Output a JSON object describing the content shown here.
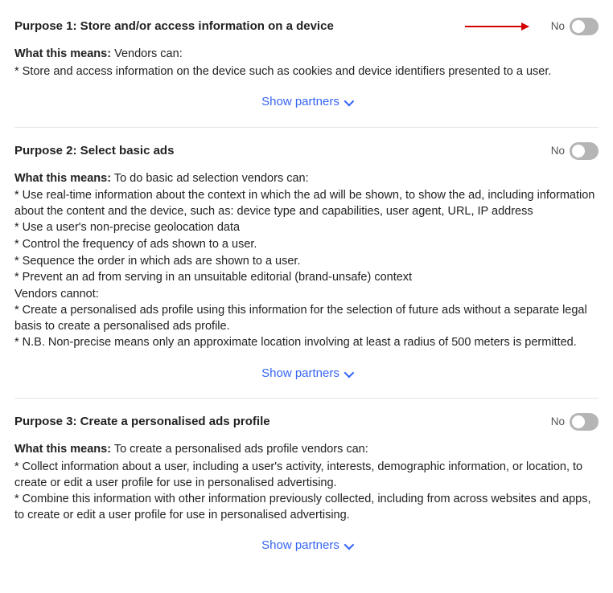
{
  "show_partners_label": "Show partners",
  "toggle_state_label": "No",
  "purposes": [
    {
      "title": "Purpose 1: Store and/or access information on a device",
      "means_label": "What this means:",
      "means_intro": " Vendors can:",
      "bullets": [
        "* Store and access information on the device such as cookies and device identifiers presented to a user."
      ],
      "arrow": true
    },
    {
      "title": "Purpose 2: Select basic ads",
      "means_label": "What this means:",
      "means_intro": " To do basic ad selection vendors can:",
      "bullets": [
        "* Use real-time information about the context in which the ad will be shown, to show the ad, including information about the content and the device, such as: device type and capabilities, user agent, URL, IP address",
        "* Use a user's non-precise geolocation data",
        "* Control the frequency of ads shown to a user.",
        "* Sequence the order in which ads are shown to a user.",
        "* Prevent an ad from serving in an unsuitable editorial (brand-unsafe) context",
        "Vendors cannot:",
        "* Create a personalised ads profile using this information for the selection of future ads without a separate legal basis to create a personalised ads profile.",
        "* N.B. Non-precise means only an approximate location involving at least a radius of 500 meters is permitted."
      ],
      "arrow": false
    },
    {
      "title": "Purpose 3: Create a personalised ads profile",
      "means_label": "What this means:",
      "means_intro": " To create a personalised ads profile vendors can:",
      "bullets": [
        "* Collect information about a user, including a user's activity, interests, demographic information, or location, to create or edit a user profile for use in personalised advertising.",
        "* Combine this information with other information previously collected, including from across websites and apps, to create or edit a user profile for use in personalised advertising."
      ],
      "arrow": false
    }
  ]
}
